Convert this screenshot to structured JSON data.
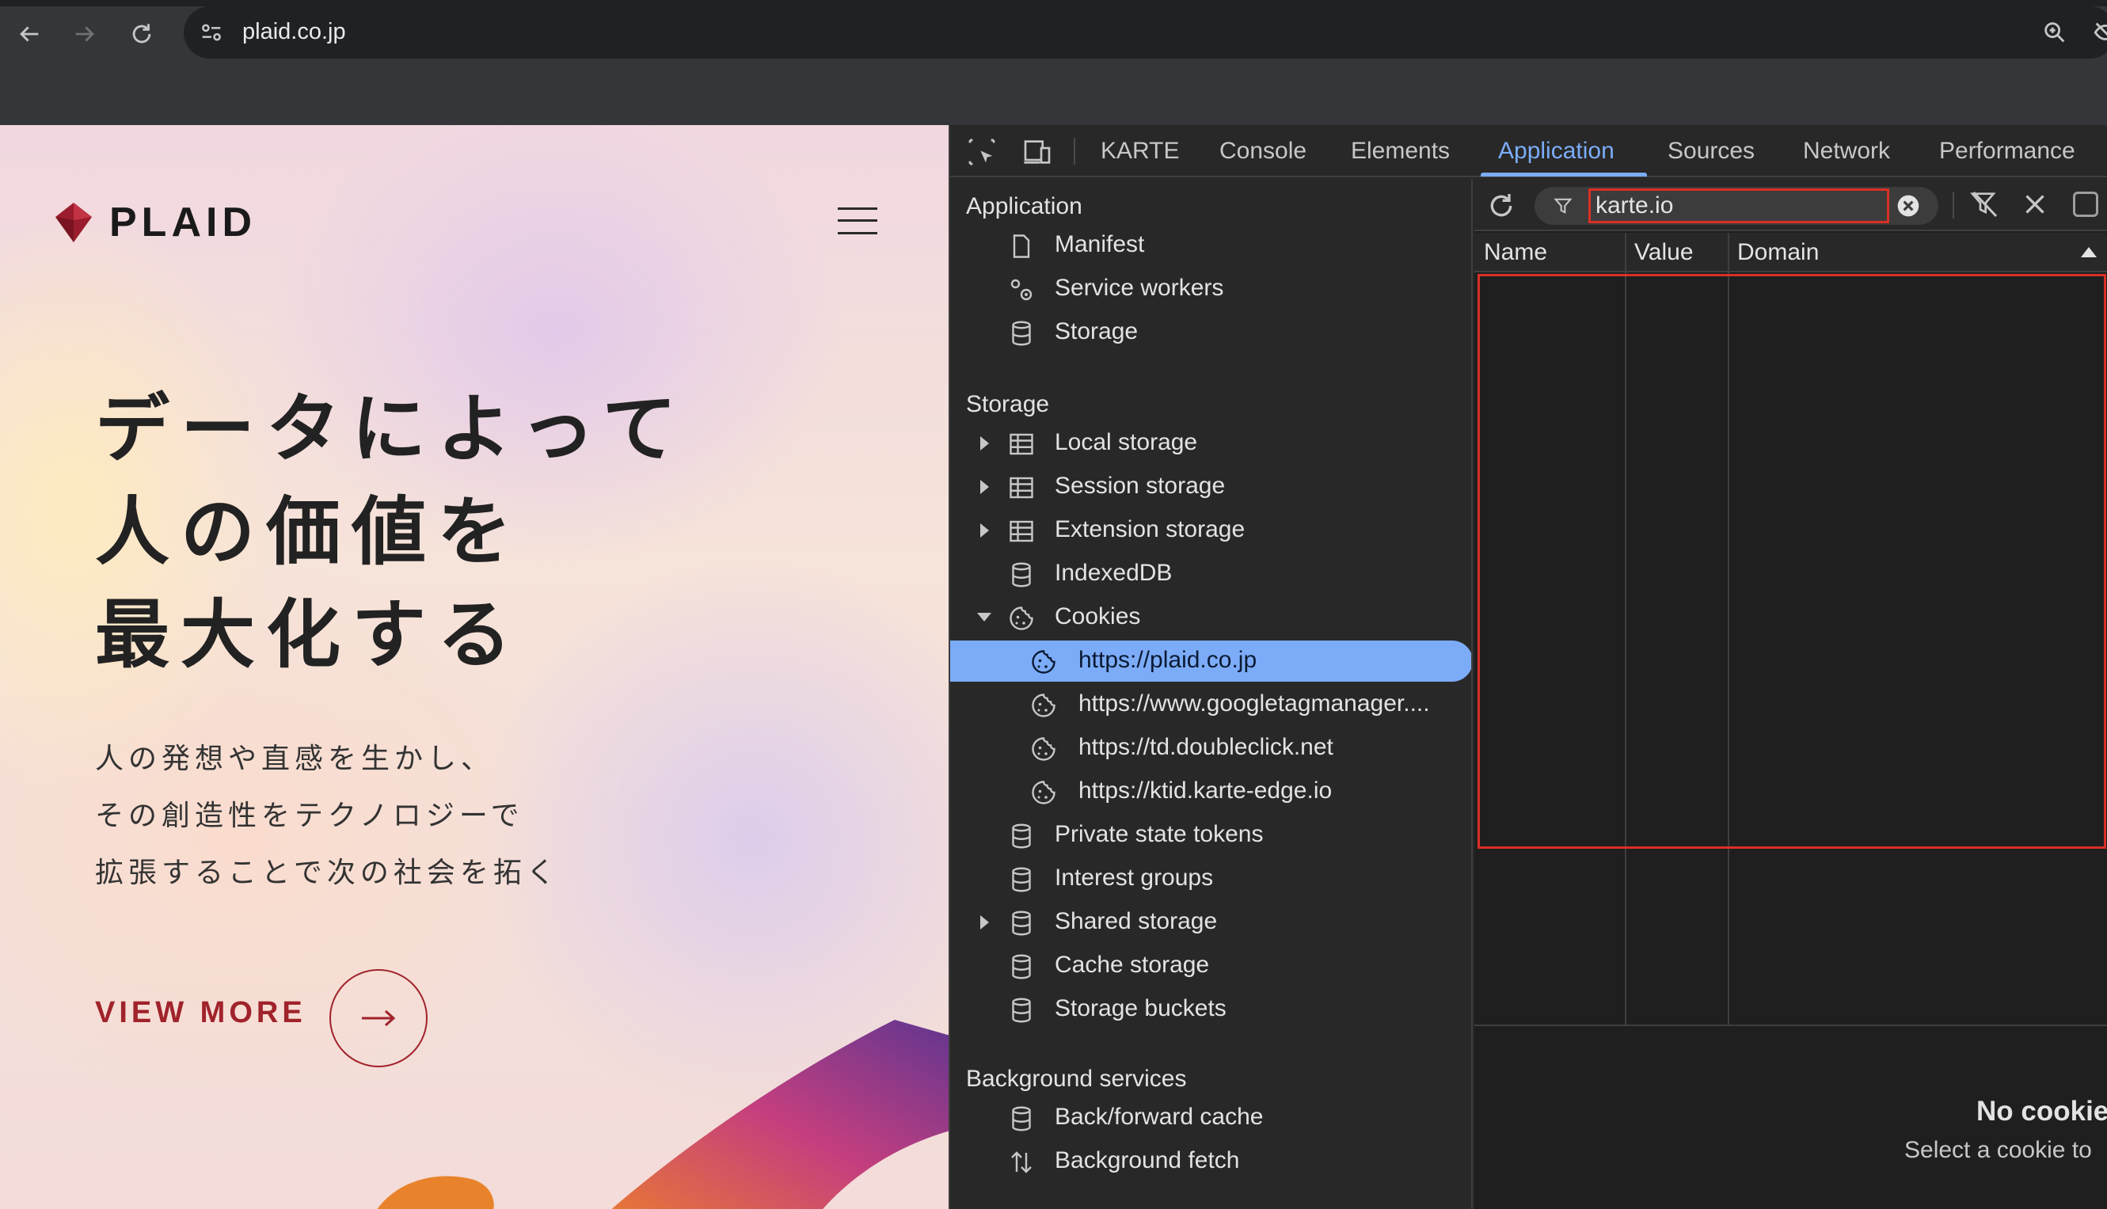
{
  "browser": {
    "url": "plaid.co.jp"
  },
  "site": {
    "logo_text": "PLAID",
    "hero_lines": [
      "データによって",
      "人の価値を",
      "最大化する"
    ],
    "sub_lines": [
      "人の発想や直感を生かし、",
      "その創造性をテクノロジーで",
      "拡張することで次の社会を拓く"
    ],
    "view_more": "VIEW MORE"
  },
  "devtools": {
    "tabs": [
      "KARTE",
      "Console",
      "Elements",
      "Application",
      "Sources",
      "Network",
      "Performance"
    ],
    "active_tab": "Application",
    "sections": {
      "application": {
        "title": "Application",
        "items": [
          "Manifest",
          "Service workers",
          "Storage"
        ]
      },
      "storage": {
        "title": "Storage",
        "items": [
          "Local storage",
          "Session storage",
          "Extension storage",
          "IndexedDB",
          "Cookies"
        ],
        "cookies": [
          "https://plaid.co.jp",
          "https://www.googletagmanager....",
          "https://td.doubleclick.net",
          "https://ktid.karte-edge.io"
        ],
        "more_items": [
          "Private state tokens",
          "Interest groups",
          "Shared storage",
          "Cache storage",
          "Storage buckets"
        ]
      },
      "background": {
        "title": "Background services",
        "items": [
          "Back/forward cache",
          "Background fetch"
        ]
      }
    },
    "filter": {
      "value": "karte.io"
    },
    "columns": [
      "Name",
      "Value",
      "Domain"
    ],
    "empty_title": "No cookie",
    "empty_sub": "Select a cookie to"
  }
}
